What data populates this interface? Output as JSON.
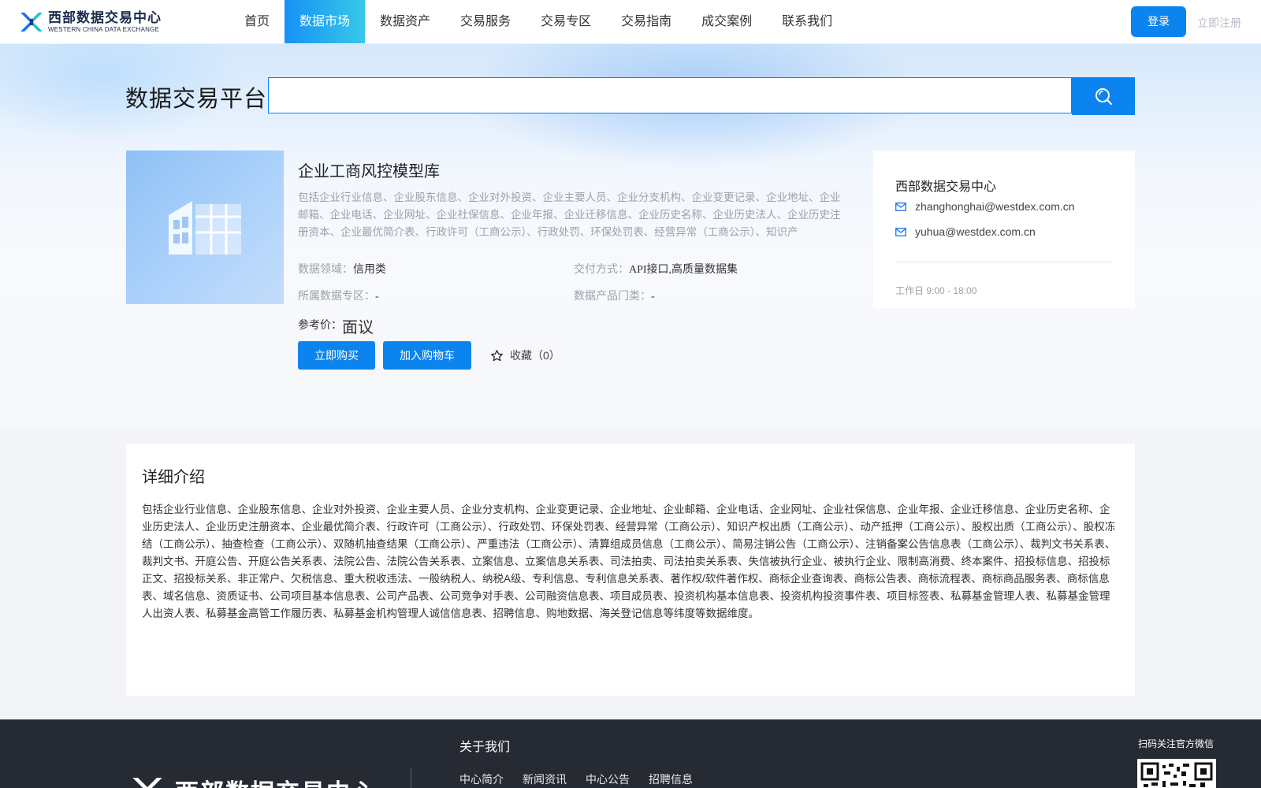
{
  "nav": {
    "logo_cn": "西部数据交易中心",
    "logo_en": "WESTERN CHINA DATA EXCHANGE",
    "items": [
      {
        "label": "首页",
        "active": false
      },
      {
        "label": "数据市场",
        "active": true
      },
      {
        "label": "数据资产",
        "active": false
      },
      {
        "label": "交易服务",
        "active": false
      },
      {
        "label": "交易专区",
        "active": false
      },
      {
        "label": "交易指南",
        "active": false
      },
      {
        "label": "成交案例",
        "active": false
      },
      {
        "label": "联系我们",
        "active": false
      }
    ],
    "login_label": "登录",
    "register_label": "立即注册",
    "accent": "#0c84f0"
  },
  "hero": {
    "title": "数据交易平台",
    "search_placeholder": "",
    "search_value": ""
  },
  "product": {
    "image_icon": "building-icon",
    "title": "企业工商风控模型库",
    "description": "包括企业行业信息、企业股东信息、企业对外投资、企业主要人员、企业分支机构、企业变更记录、企业地址、企业邮箱、企业电话、企业网址、企业社保信息、企业年报、企业迁移信息、企业历史名称、企业历史法人、企业历史注册资本、企业最优简介表、行政许可（工商公示）、行政处罚、环保处罚表、经营异常（工商公示）、知识产",
    "domain_label": "数据领域：",
    "domain_value": "信用类",
    "delivery_label": "交付方式：",
    "delivery_value": "API接口,高质量数据集",
    "zone_label": "所属数据专区：",
    "zone_value": "-",
    "category_label": "数据产品门类：",
    "category_value": "-",
    "price_label": "参考价：",
    "price_value": "面议",
    "buy_label": "立即购买",
    "cart_label": "加入购物车",
    "favorite_label": "收藏（0）"
  },
  "contact": {
    "title": "西部数据交易中心",
    "emails": [
      "zhanghonghai@westdex.com.cn",
      "yuhua@westdex.com.cn"
    ],
    "hours": "工作日 9:00 - 18:00"
  },
  "detail": {
    "title": "详细介绍",
    "text": "包括企业行业信息、企业股东信息、企业对外投资、企业主要人员、企业分支机构、企业变更记录、企业地址、企业邮箱、企业电话、企业网址、企业社保信息、企业年报、企业迁移信息、企业历史名称、企业历史法人、企业历史注册资本、企业最优简介表、行政许可（工商公示）、行政处罚、环保处罚表、经营异常（工商公示）、知识产权出质（工商公示）、动产抵押（工商公示）、股权出质（工商公示）、股权冻结（工商公示）、抽查检查（工商公示）、双随机抽查结果（工商公示）、严重违法（工商公示）、清算组成员信息（工商公示）、简易注销公告（工商公示）、注销备案公告信息表（工商公示）、裁判文书关系表、裁判文书、开庭公告、开庭公告关系表、法院公告、法院公告关系表、立案信息、立案信息关系表、司法拍卖、司法拍卖关系表、失信被执行企业、被执行企业、限制高消费、终本案件、招投标信息、招投标正文、招投标关系、非正常户、欠税信息、重大税收违法、一般纳税人、纳税A级、专利信息、专利信息关系表、著作权/软件著作权、商标企业查询表、商标公告表、商标流程表、商标商品服务表、商标信息表、域名信息、资质证书、公司项目基本信息表、公司产品表、公司竞争对手表、公司融资信息表、项目成员表、投资机构基本信息表、投资机构投资事件表、项目标签表、私募基金管理人表、私募基金管理人出资人表、私募基金高管工作履历表、私募基金机构管理人诚信信息表、招聘信息、购地数据、海关登记信息等纬度等数据维度。"
  },
  "footer": {
    "logo_text": "西部数据交易中心",
    "about_title": "关于我们",
    "links": [
      "中心简介",
      "新闻资讯",
      "中心公告",
      "招聘信息"
    ],
    "qr_label": "扫码关注官方微信"
  }
}
